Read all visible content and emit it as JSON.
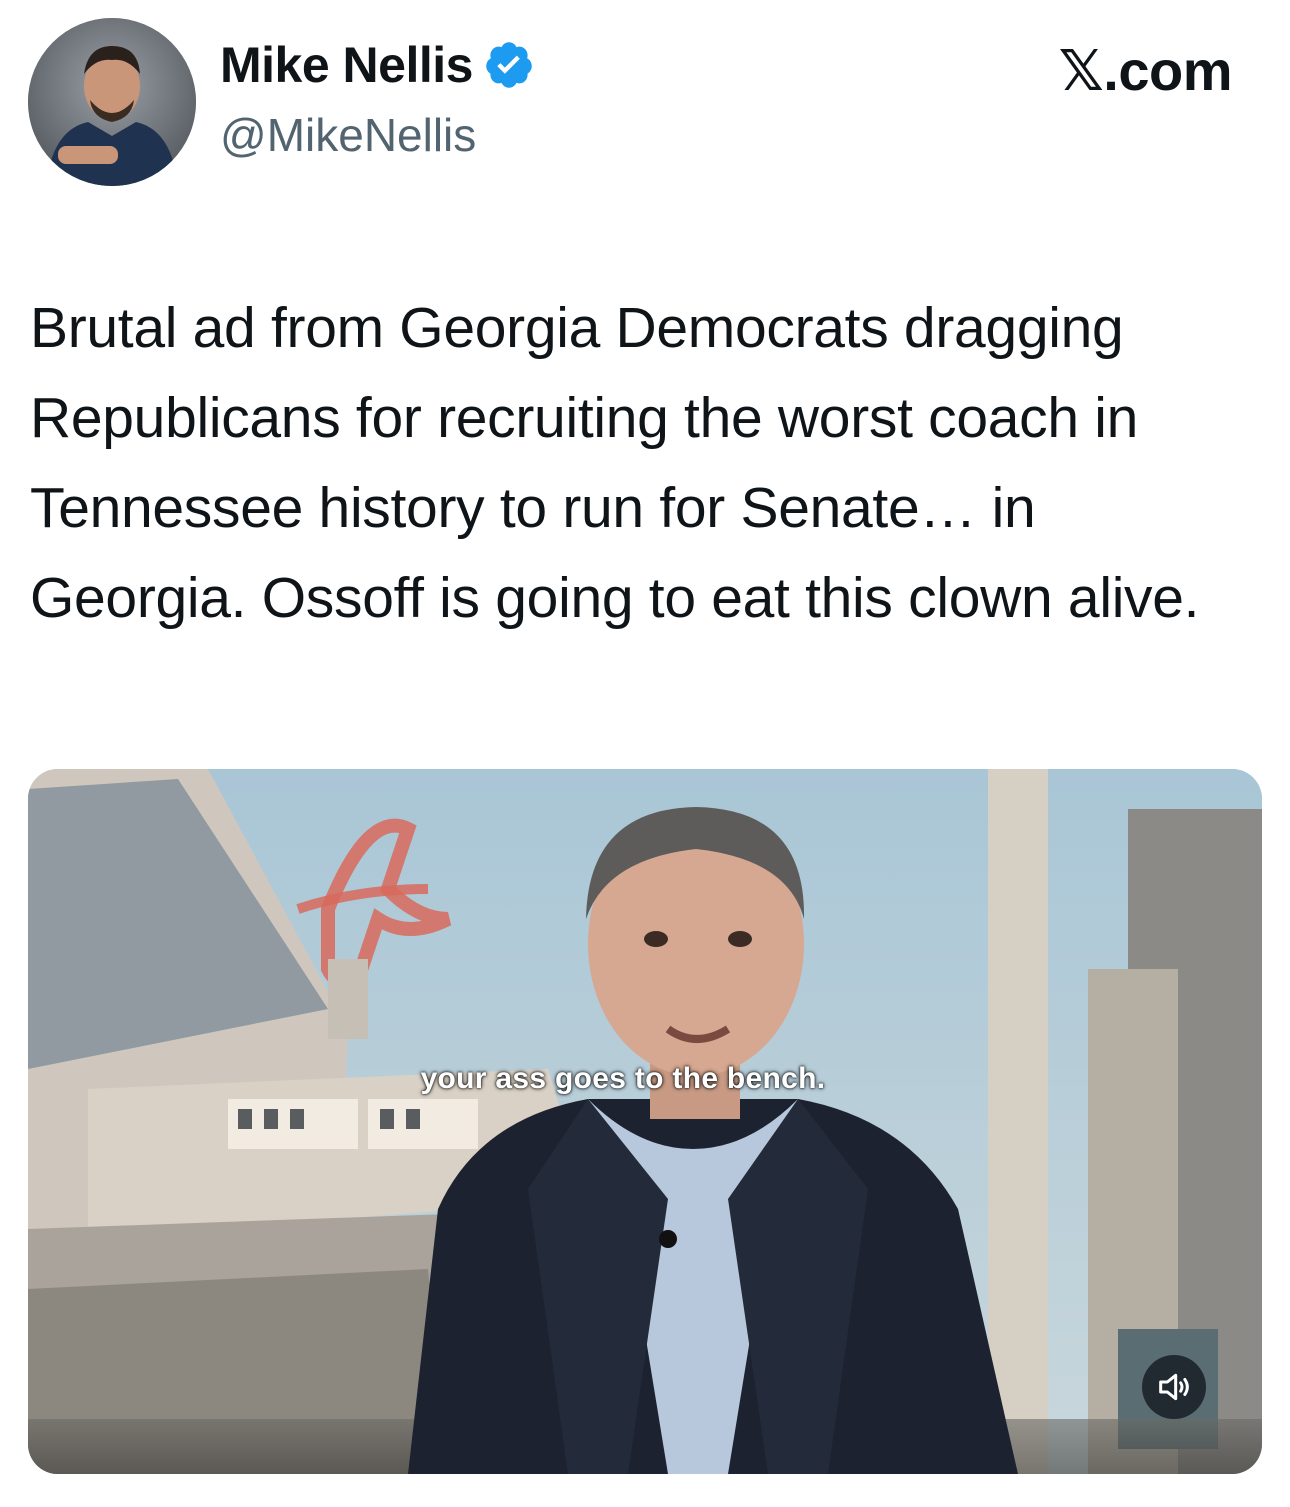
{
  "author": {
    "name": "Mike Nellis",
    "handle": "@MikeNellis",
    "verified": true,
    "verified_color": "#1d9bf0"
  },
  "brand": "𝕏.com",
  "tweet": {
    "text": "Brutal ad from Georgia Democrats dragging Republicans for recruiting the worst coach in Tennessee history to run for Senate… in Georgia. Ossoff is going to eat this clown alive."
  },
  "media": {
    "type": "video",
    "caption": "your ass goes to the bench.",
    "sound_icon": "speaker-muted-icon"
  }
}
